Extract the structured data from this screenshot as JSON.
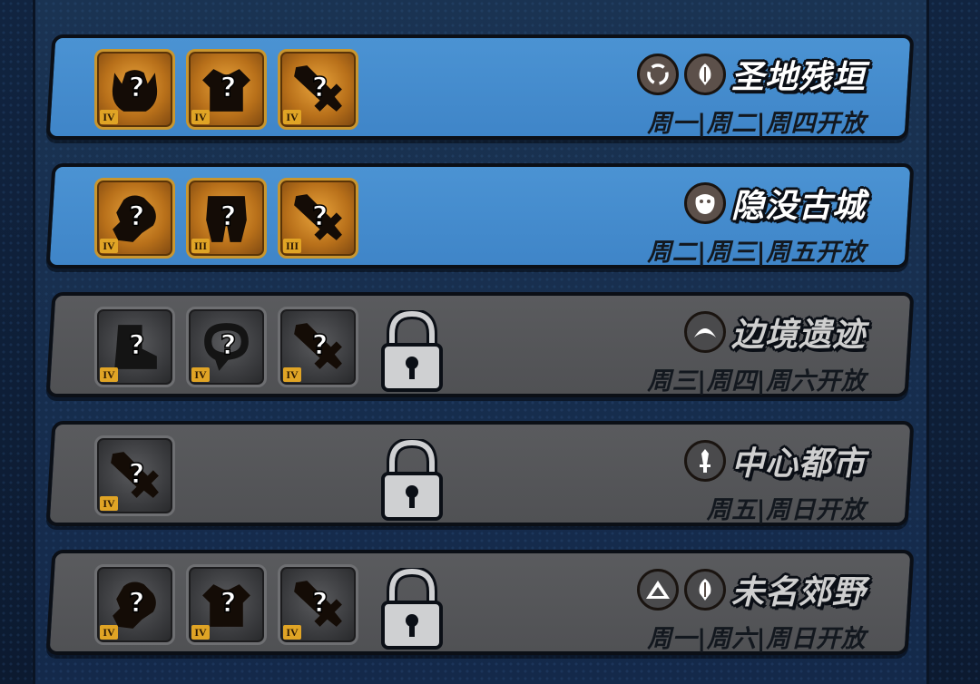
{
  "dungeons": [
    {
      "name": "圣地残垣",
      "schedule": "周一|周二|周四开放",
      "state": "unlocked",
      "elements": [
        "swirl-element-icon",
        "wing-element-icon"
      ],
      "rewards": [
        {
          "icon": "helmet-silhouette-icon",
          "tier": "IV"
        },
        {
          "icon": "armor-silhouette-icon",
          "tier": "IV"
        },
        {
          "icon": "sword-silhouette-icon",
          "tier": "IV"
        }
      ]
    },
    {
      "name": "隐没古城",
      "schedule": "周二|周三|周五开放",
      "state": "unlocked",
      "elements": [
        "beast-element-icon"
      ],
      "rewards": [
        {
          "icon": "gauntlet-silhouette-icon",
          "tier": "IV"
        },
        {
          "icon": "leggings-silhouette-icon",
          "tier": "III"
        },
        {
          "icon": "sword-silhouette-icon",
          "tier": "III"
        }
      ]
    },
    {
      "name": "边境遗迹",
      "schedule": "周三|周四|周六开放",
      "state": "locked",
      "elements": [
        "crescent-element-icon"
      ],
      "rewards": [
        {
          "icon": "boots-silhouette-icon",
          "tier": "IV"
        },
        {
          "icon": "amulet-silhouette-icon",
          "tier": "IV"
        },
        {
          "icon": "sword-silhouette-icon",
          "tier": "IV"
        }
      ]
    },
    {
      "name": "中心都市",
      "schedule": "周五|周日开放",
      "state": "locked",
      "elements": [
        "blade-element-icon"
      ],
      "rewards": [
        {
          "icon": "sword-silhouette-icon",
          "tier": "IV"
        }
      ]
    },
    {
      "name": "未名郊野",
      "schedule": "周一|周六|周日开放",
      "state": "locked",
      "elements": [
        "triangle-element-icon",
        "wing-element-icon"
      ],
      "rewards": [
        {
          "icon": "gauntlet-silhouette-icon",
          "tier": "IV"
        },
        {
          "icon": "armor-silhouette-icon",
          "tier": "IV"
        },
        {
          "icon": "sword-silhouette-icon",
          "tier": "IV"
        }
      ]
    }
  ],
  "colors": {
    "active_panel": "#4b93d3",
    "locked_panel": "#5a5b5e",
    "tier_badge": "#e0a425",
    "reward_gold": "#e9a43c"
  }
}
